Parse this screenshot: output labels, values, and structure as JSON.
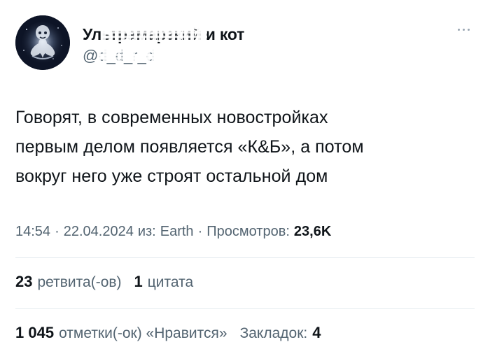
{
  "tweet": {
    "author": {
      "display_name": "Ультрамарзкий и кот",
      "handle": "@d_d_r_d"
    },
    "text": "Говорят, в современных новостройках\nпервым делом появляется «К&Б», а потом\nвокруг него уже строят остальной дом",
    "meta": {
      "time": "14:54",
      "date": "22.04.2024",
      "source_prefix": "из:",
      "source": "Earth",
      "views_label": "Просмотров:",
      "views": "23,6K"
    },
    "stats": {
      "retweets": "23",
      "retweets_label": "ретвита(-ов)",
      "quotes": "1",
      "quotes_label": "цитата",
      "likes": "1 045",
      "likes_label": "отметки(-ок) «Нравится»",
      "bookmarks_label": "Закладок:",
      "bookmarks": "4"
    }
  },
  "icons": {
    "more": "more-horizontal-icon"
  },
  "colors": {
    "text_primary": "#0f1419",
    "text_secondary": "#536471",
    "divider": "#e6ecf0",
    "more_icon": "#9aa6b2"
  }
}
